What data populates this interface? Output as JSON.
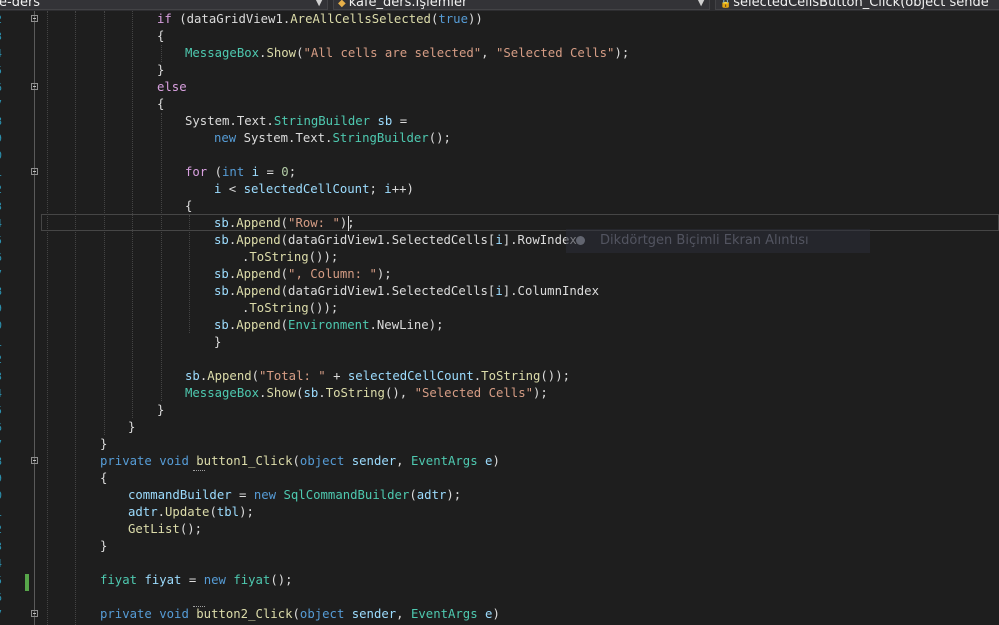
{
  "nav": {
    "project": "e-ders",
    "class": "kafe_ders.İşlemler",
    "member": "selectedCellsButton_Click(object sende"
  },
  "tooltip": "Dikdörtgen Biçimli Ekran Alıntısı",
  "code_lines": [
    {
      "n": "2",
      "tokens": [
        [
          "ctl",
          "if"
        ],
        [
          "pl",
          " (dataGridView1."
        ],
        [
          "fn",
          "AreAllCellsSelected"
        ],
        [
          "pl",
          "("
        ],
        [
          "kw",
          "true"
        ],
        [
          "pl",
          "))"
        ]
      ]
    },
    {
      "n": "3",
      "tokens": [
        [
          "pl",
          "{"
        ]
      ]
    },
    {
      "n": "4",
      "tokens": [
        [
          "ty",
          "MessageBox"
        ],
        [
          "pl",
          "."
        ],
        [
          "fn",
          "Show"
        ],
        [
          "pl",
          "("
        ],
        [
          "st",
          "\"All cells are selected\""
        ],
        [
          "pl",
          ", "
        ],
        [
          "st",
          "\"Selected Cells\""
        ],
        [
          "pl",
          ");"
        ]
      ]
    },
    {
      "n": "5",
      "tokens": [
        [
          "pl",
          "}"
        ]
      ]
    },
    {
      "n": "6",
      "tokens": [
        [
          "ctl",
          "else"
        ]
      ]
    },
    {
      "n": "7",
      "tokens": [
        [
          "pl",
          "{"
        ]
      ]
    },
    {
      "n": "8",
      "tokens": [
        [
          "pl",
          "System.Text."
        ],
        [
          "ty",
          "StringBuilder"
        ],
        [
          "pl",
          " "
        ],
        [
          "vr",
          "sb"
        ],
        [
          "pl",
          " ="
        ]
      ]
    },
    {
      "n": "9",
      "tokens": [
        [
          "kw",
          "new"
        ],
        [
          "pl",
          " System.Text."
        ],
        [
          "ty",
          "StringBuilder"
        ],
        [
          "pl",
          "();"
        ]
      ]
    },
    {
      "n": "0",
      "tokens": []
    },
    {
      "n": "1",
      "tokens": [
        [
          "ctl",
          "for"
        ],
        [
          "pl",
          " ("
        ],
        [
          "kw",
          "int"
        ],
        [
          "pl",
          " "
        ],
        [
          "vr",
          "i"
        ],
        [
          "pl",
          " = "
        ],
        [
          "nm",
          "0"
        ],
        [
          "pl",
          ";"
        ]
      ]
    },
    {
      "n": "2",
      "tokens": [
        [
          "vr",
          "i"
        ],
        [
          "pl",
          " < "
        ],
        [
          "vr",
          "selectedCellCount"
        ],
        [
          "pl",
          "; "
        ],
        [
          "vr",
          "i"
        ],
        [
          "pl",
          "++)"
        ]
      ]
    },
    {
      "n": "3",
      "tokens": [
        [
          "pl",
          "{"
        ]
      ]
    },
    {
      "n": "4",
      "tokens": [
        [
          "vr",
          "sb"
        ],
        [
          "pl",
          "."
        ],
        [
          "fn",
          "Append"
        ],
        [
          "pl",
          "("
        ],
        [
          "st",
          "\"Row: \""
        ],
        [
          "pl",
          ");"
        ]
      ]
    },
    {
      "n": "5",
      "tokens": [
        [
          "vr",
          "sb"
        ],
        [
          "pl",
          "."
        ],
        [
          "fn",
          "Append"
        ],
        [
          "pl",
          "(dataGridView1.SelectedCells["
        ],
        [
          "vr",
          "i"
        ],
        [
          "pl",
          "].RowIndex"
        ]
      ]
    },
    {
      "n": "6",
      "tokens": [
        [
          "pl",
          "."
        ],
        [
          "fn",
          "ToString"
        ],
        [
          "pl",
          "());"
        ]
      ]
    },
    {
      "n": "7",
      "tokens": [
        [
          "vr",
          "sb"
        ],
        [
          "pl",
          "."
        ],
        [
          "fn",
          "Append"
        ],
        [
          "pl",
          "("
        ],
        [
          "st",
          "\", Column: \""
        ],
        [
          "pl",
          ");"
        ]
      ]
    },
    {
      "n": "8",
      "tokens": [
        [
          "vr",
          "sb"
        ],
        [
          "pl",
          "."
        ],
        [
          "fn",
          "Append"
        ],
        [
          "pl",
          "(dataGridView1.SelectedCells["
        ],
        [
          "vr",
          "i"
        ],
        [
          "pl",
          "].ColumnIndex"
        ]
      ]
    },
    {
      "n": "9",
      "tokens": [
        [
          "pl",
          "."
        ],
        [
          "fn",
          "ToString"
        ],
        [
          "pl",
          "());"
        ]
      ]
    },
    {
      "n": "0",
      "tokens": [
        [
          "vr",
          "sb"
        ],
        [
          "pl",
          "."
        ],
        [
          "fn",
          "Append"
        ],
        [
          "pl",
          "("
        ],
        [
          "ty",
          "Environment"
        ],
        [
          "pl",
          ".NewLine);"
        ]
      ]
    },
    {
      "n": "1",
      "tokens": [
        [
          "pl",
          "}"
        ]
      ]
    },
    {
      "n": "2",
      "tokens": []
    },
    {
      "n": "3",
      "tokens": [
        [
          "vr",
          "sb"
        ],
        [
          "pl",
          "."
        ],
        [
          "fn",
          "Append"
        ],
        [
          "pl",
          "("
        ],
        [
          "st",
          "\"Total: \""
        ],
        [
          "pl",
          " + "
        ],
        [
          "vr",
          "selectedCellCount"
        ],
        [
          "pl",
          "."
        ],
        [
          "fn",
          "ToString"
        ],
        [
          "pl",
          "());"
        ]
      ]
    },
    {
      "n": "4",
      "tokens": [
        [
          "ty",
          "MessageBox"
        ],
        [
          "pl",
          "."
        ],
        [
          "fn",
          "Show"
        ],
        [
          "pl",
          "("
        ],
        [
          "vr",
          "sb"
        ],
        [
          "pl",
          "."
        ],
        [
          "fn",
          "ToString"
        ],
        [
          "pl",
          "(), "
        ],
        [
          "st",
          "\"Selected Cells\""
        ],
        [
          "pl",
          ");"
        ]
      ]
    },
    {
      "n": "5",
      "tokens": [
        [
          "pl",
          "}"
        ]
      ]
    },
    {
      "n": "6",
      "tokens": [
        [
          "pl",
          "}"
        ]
      ]
    },
    {
      "n": "7",
      "tokens": [
        [
          "pl",
          "}"
        ]
      ]
    },
    {
      "n": "8",
      "tokens": [
        [
          "kw",
          "private"
        ],
        [
          "pl",
          " "
        ],
        [
          "kw",
          "void"
        ],
        [
          "pl",
          " "
        ],
        [
          "fn",
          "button1_Click"
        ],
        [
          "pl",
          "("
        ],
        [
          "kw",
          "object"
        ],
        [
          "pl",
          " "
        ],
        [
          "vr",
          "sender"
        ],
        [
          "pl",
          ", "
        ],
        [
          "ty",
          "EventArgs"
        ],
        [
          "pl",
          " "
        ],
        [
          "vr",
          "e"
        ],
        [
          "pl",
          ")"
        ]
      ]
    },
    {
      "n": "9",
      "tokens": [
        [
          "pl",
          "{"
        ]
      ]
    },
    {
      "n": "0",
      "tokens": [
        [
          "vr",
          "commandBuilder"
        ],
        [
          "pl",
          " = "
        ],
        [
          "kw",
          "new"
        ],
        [
          "pl",
          " "
        ],
        [
          "ty",
          "SqlCommandBuilder"
        ],
        [
          "pl",
          "("
        ],
        [
          "vr",
          "adtr"
        ],
        [
          "pl",
          ");"
        ]
      ]
    },
    {
      "n": "1",
      "tokens": [
        [
          "vr",
          "adtr"
        ],
        [
          "pl",
          "."
        ],
        [
          "fn",
          "Update"
        ],
        [
          "pl",
          "("
        ],
        [
          "vr",
          "tbl"
        ],
        [
          "pl",
          ");"
        ]
      ]
    },
    {
      "n": "2",
      "tokens": [
        [
          "fn",
          "GetList"
        ],
        [
          "pl",
          "();"
        ]
      ]
    },
    {
      "n": "3",
      "tokens": [
        [
          "pl",
          "}"
        ]
      ]
    },
    {
      "n": "4",
      "tokens": []
    },
    {
      "n": "5",
      "tokens": [
        [
          "ty",
          "fiyat"
        ],
        [
          "pl",
          " "
        ],
        [
          "vr",
          "fiyat"
        ],
        [
          "pl",
          " = "
        ],
        [
          "kw",
          "new"
        ],
        [
          "pl",
          " "
        ],
        [
          "ty",
          "fiyat"
        ],
        [
          "pl",
          "();"
        ]
      ]
    },
    {
      "n": "6",
      "tokens": []
    },
    {
      "n": "7",
      "tokens": [
        [
          "kw",
          "private"
        ],
        [
          "pl",
          " "
        ],
        [
          "kw",
          "void"
        ],
        [
          "pl",
          " "
        ],
        [
          "fn",
          "button2_Click"
        ],
        [
          "pl",
          "("
        ],
        [
          "kw",
          "object"
        ],
        [
          "pl",
          " "
        ],
        [
          "vr",
          "sender"
        ],
        [
          "pl",
          ", "
        ],
        [
          "ty",
          "EventArgs"
        ],
        [
          "pl",
          " "
        ],
        [
          "vr",
          "e"
        ],
        [
          "pl",
          ")"
        ]
      ]
    }
  ]
}
